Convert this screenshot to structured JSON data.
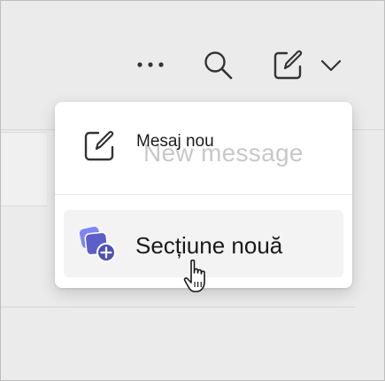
{
  "toolbar": {
    "more_icon": "more-horizontal-icon",
    "search_icon": "search-icon",
    "compose_icon": "compose-icon",
    "chevron_icon": "chevron-down-icon"
  },
  "menu": {
    "new_message": {
      "label": "Mesaj nou",
      "ghost_label": "New message",
      "icon": "compose-icon"
    },
    "new_section": {
      "label": "Secțiune nouă",
      "icon": "new-section-icon"
    }
  },
  "colors": {
    "accent": "#5b5fc7",
    "accent_dark": "#4f52b2",
    "accent_light": "#7f85f5",
    "background": "#ebebeb",
    "menu_background": "#ffffff",
    "hover": "#f3f3f3"
  },
  "cursor": "hand-pointer-icon"
}
